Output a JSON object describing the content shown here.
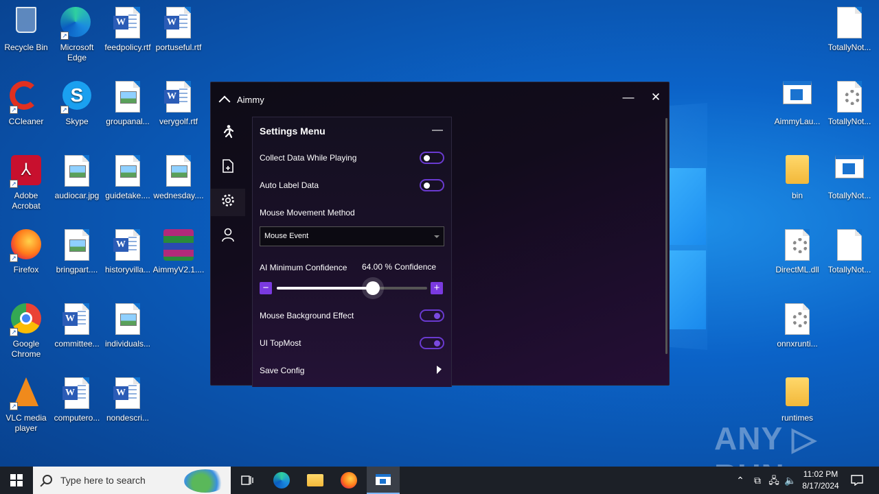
{
  "desktop": {
    "icons_left": [
      {
        "label": "Recycle Bin",
        "icon": "recycle-bin-icon"
      },
      {
        "label": "Microsoft Edge",
        "icon": "edge-icon"
      },
      {
        "label": "feedpolicy.rtf",
        "icon": "word-doc-icon"
      },
      {
        "label": "portuseful.rtf",
        "icon": "word-doc-icon"
      },
      {
        "label": "CCleaner",
        "icon": "ccleaner-icon"
      },
      {
        "label": "Skype",
        "icon": "skype-icon"
      },
      {
        "label": "groupanal...",
        "icon": "image-file-icon"
      },
      {
        "label": "verygolf.rtf",
        "icon": "word-doc-icon"
      },
      {
        "label": "Adobe Acrobat",
        "icon": "acrobat-icon"
      },
      {
        "label": "audiocar.jpg",
        "icon": "image-file-icon"
      },
      {
        "label": "guidetake....",
        "icon": "image-file-icon"
      },
      {
        "label": "wednesday....",
        "icon": "image-file-icon"
      },
      {
        "label": "Firefox",
        "icon": "firefox-icon"
      },
      {
        "label": "bringpart....",
        "icon": "image-file-icon"
      },
      {
        "label": "historyvilla...",
        "icon": "word-doc-icon"
      },
      {
        "label": "AimmyV2.1....",
        "icon": "winrar-icon"
      },
      {
        "label": "Google Chrome",
        "icon": "chrome-icon"
      },
      {
        "label": "committee...",
        "icon": "word-doc-icon"
      },
      {
        "label": "individuals...",
        "icon": "image-file-icon"
      },
      {
        "label": "VLC media player",
        "icon": "vlc-icon"
      },
      {
        "label": "computero...",
        "icon": "word-doc-icon"
      },
      {
        "label": "nondescri...",
        "icon": "word-doc-icon"
      }
    ],
    "icons_right": [
      {
        "label": "TotallyNot...",
        "icon": "blank-file-icon"
      },
      {
        "label": "AimmyLau...",
        "icon": "app-window-icon"
      },
      {
        "label": "TotallyNot...",
        "icon": "settings-file-icon"
      },
      {
        "label": "bin",
        "icon": "folder-icon"
      },
      {
        "label": "TotallyNot...",
        "icon": "app-window-icon"
      },
      {
        "label": "DirectML.dll",
        "icon": "settings-file-icon"
      },
      {
        "label": "TotallyNot...",
        "icon": "blank-file-icon"
      },
      {
        "label": "onnxrunti...",
        "icon": "settings-file-icon"
      },
      {
        "label": "runtimes",
        "icon": "folder-icon"
      }
    ]
  },
  "window": {
    "title": "Aimmy",
    "minimize_glyph": "—",
    "close_glyph": "✕",
    "sidebar": [
      {
        "icon": "aim-person-icon"
      },
      {
        "icon": "model-file-icon"
      },
      {
        "icon": "settings-gear-icon",
        "active": true
      },
      {
        "icon": "account-icon"
      }
    ]
  },
  "settings": {
    "header": "Settings Menu",
    "collapse_glyph": "—",
    "collect_data_label": "Collect Data While Playing",
    "collect_data_on": false,
    "auto_label_label": "Auto Label Data",
    "auto_label_on": false,
    "mouse_method_label": "Mouse Movement Method",
    "mouse_method_value": "Mouse Event",
    "confidence_label": "AI Minimum Confidence",
    "confidence_value": "64.00 % Confidence",
    "confidence_fraction": 0.64,
    "minus_glyph": "−",
    "plus_glyph": "+",
    "bg_effect_label": "Mouse Background Effect",
    "bg_effect_on": true,
    "topmost_label": "UI TopMost",
    "topmost_on": true,
    "save_label": "Save Config"
  },
  "taskbar": {
    "search_placeholder": "Type here to search",
    "time": "11:02 PM",
    "date": "8/17/2024"
  },
  "watermark": "ANY ▷ RUN"
}
